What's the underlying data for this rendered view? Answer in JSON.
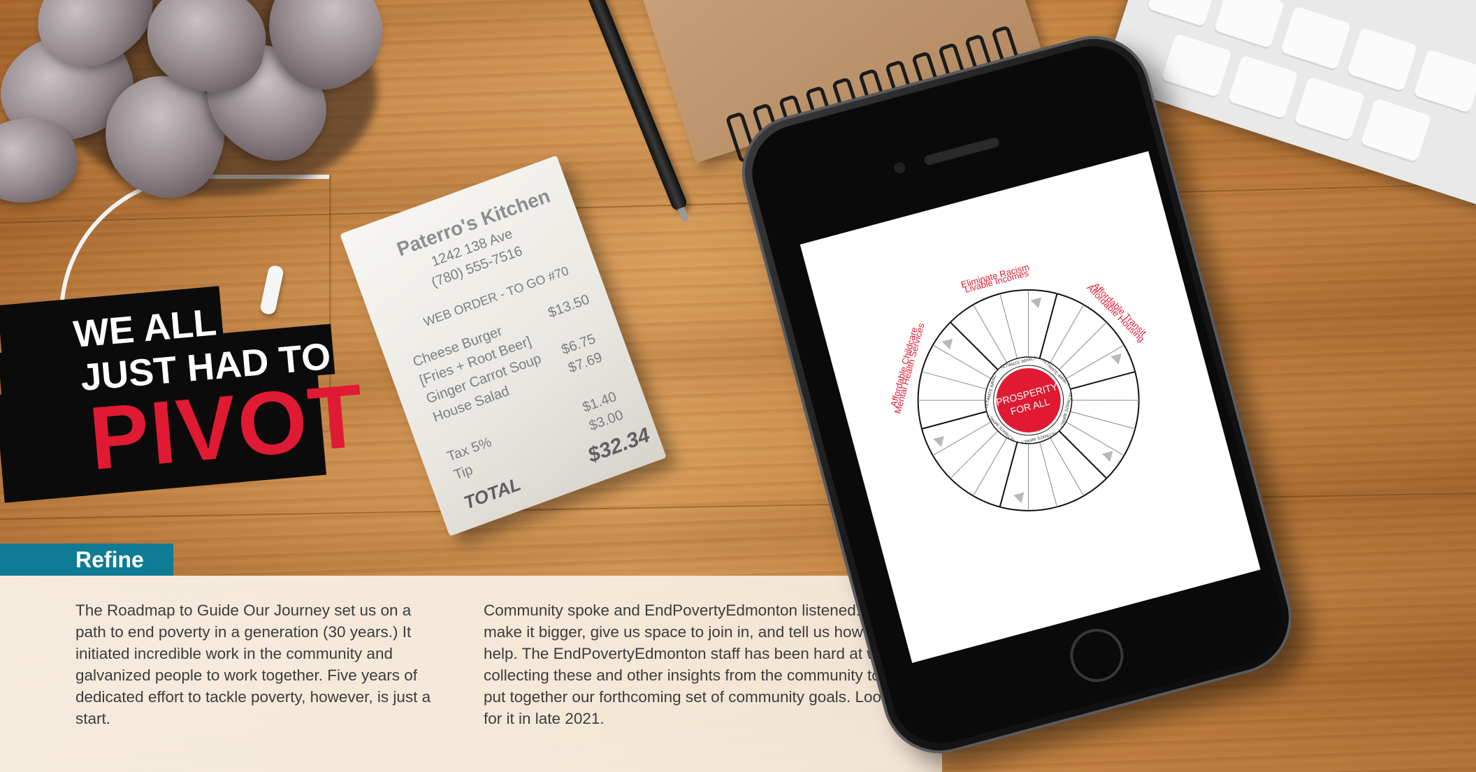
{
  "headline": {
    "line1": "WE ALL",
    "line2": "JUST HAD TO",
    "line3": "PIVOT"
  },
  "receipt": {
    "restaurant": "Paterro's Kitchen",
    "address": "1242 138 Ave",
    "phone": "(780) 555-7516",
    "order": "WEB ORDER - TO GO #70",
    "items": [
      {
        "name": "Cheese Burger",
        "price": "$13.50"
      },
      {
        "name": "[Fries + Root Beer]",
        "price": ""
      },
      {
        "name": "Ginger Carrot Soup",
        "price": "$6.75"
      },
      {
        "name": "House Salad",
        "price": "$7.69"
      }
    ],
    "tax_label": "Tax 5%",
    "tax_value": "$1.40",
    "tip_label": "Tip",
    "tip_value": "$3.00",
    "total_label": "TOTAL",
    "total_value": "$32.34"
  },
  "section": {
    "tab_label": "Refine",
    "paragraph1": "The Roadmap to Guide Our Journey set us on a path to end poverty in a generation (30 years.) It initiated incredible work in the community and galvanized people to work together. Five years of dedicated effort to tackle poverty, however, is just a start.",
    "paragraph2": "Community spoke and EndPovertyEdmonton listened: make it bigger, give us space to join in, and tell us how to help. The EndPovertyEdmonton staff has been hard at work collecting these and other insights from the community to put together our forthcoming set of community goals. Look for it in late 2021."
  },
  "wheel": {
    "center_line1": "PROSPERITY",
    "center_line2": "FOR ALL",
    "inner_ring_label": "ULTIMATE IMPACT",
    "segments": [
      "Livable Incomes",
      "Affordable Housing",
      "Affordable Childcare",
      "Eliminate Racism",
      "Affordable Transit",
      "Mental Health Services"
    ],
    "accent_color": "#e01a33"
  },
  "colors": {
    "refine_tab": "#0f7b95",
    "headline_band": "#0b0b0b",
    "pivot_red": "#e01a33"
  }
}
